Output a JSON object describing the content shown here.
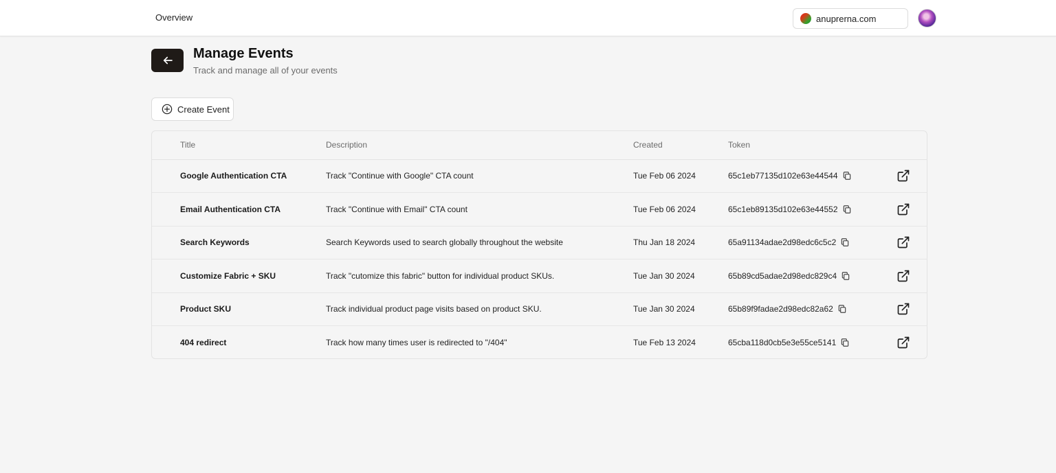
{
  "header": {
    "nav_overview": "Overview",
    "site": "anuprerna.com"
  },
  "page": {
    "title": "Manage Events",
    "subtitle": "Track and manage all of your events",
    "create_label": "Create Event"
  },
  "table": {
    "columns": [
      "Title",
      "Description",
      "Created",
      "Token"
    ],
    "rows": [
      {
        "title": "Google Authentication CTA",
        "description": "Track \"Continue with Google\" CTA count",
        "created": "Tue Feb 06 2024",
        "token": "65c1eb77135d102e63e44544"
      },
      {
        "title": "Email Authentication CTA",
        "description": "Track \"Continue with Email\" CTA count",
        "created": "Tue Feb 06 2024",
        "token": "65c1eb89135d102e63e44552"
      },
      {
        "title": "Search Keywords",
        "description": "Search Keywords used to search globally throughout the website",
        "created": "Thu Jan 18 2024",
        "token": "65a91134adae2d98edc6c5c2"
      },
      {
        "title": "Customize Fabric + SKU",
        "description": "Track \"cutomize this fabric\" button for individual product SKUs.",
        "created": "Tue Jan 30 2024",
        "token": "65b89cd5adae2d98edc829c4"
      },
      {
        "title": "Product SKU",
        "description": "Track individual product page visits based on product SKU.",
        "created": "Tue Jan 30 2024",
        "token": "65b89f9fadae2d98edc82a62"
      },
      {
        "title": "404 redirect",
        "description": "Track how many times user is redirected to \"/404\"",
        "created": "Tue Feb 13 2024",
        "token": "65cba118d0cb5e3e55ce5141"
      }
    ]
  },
  "icons": {
    "back": "arrow-left-icon",
    "create": "plus-circle-icon",
    "copy": "copy-icon",
    "open": "external-link-icon"
  },
  "colors": {
    "background": "#f5f5f5",
    "back_button": "#1f1a17",
    "border": "#e3e3e3"
  }
}
